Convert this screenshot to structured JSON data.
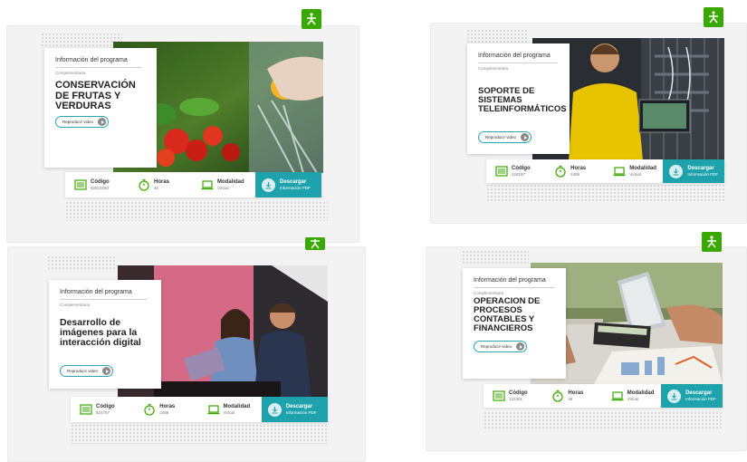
{
  "cards": [
    {
      "info_label": "Información del programa",
      "info_sub": "Complementaria",
      "title": "CONSERVACIÓN DE FRUTAS Y VERDURAS",
      "video_label": "Reproducir video",
      "codigo_label": "Código",
      "codigo_value": "92810260",
      "horas_label": "Horas",
      "horas_value": "48",
      "modalidad_label": "Modalidad",
      "modalidad_value": "Virtual",
      "descargar_label": "Descargar",
      "descargar_sub": "Información PDF"
    },
    {
      "info_label": "Información del programa",
      "info_sub": "Complementaria",
      "title": "SOPORTE DE SISTEMAS TELEINFORMÁTICOS",
      "video_label": "Reproducir video",
      "codigo_label": "Código",
      "codigo_value": "228197",
      "horas_label": "Horas",
      "horas_value": "2496",
      "modalidad_label": "Modalidad",
      "modalidad_value": "Virtual",
      "descargar_label": "Descargar",
      "descargar_sub": "Información PDF"
    },
    {
      "info_label": "Información del programa",
      "info_sub": "Complementaria",
      "title": "Desarrollo de imágenes para la interacción digital",
      "video_label": "Reproducir video",
      "codigo_label": "Código",
      "codigo_value": "524797",
      "horas_label": "Horas",
      "horas_value": "2496",
      "modalidad_label": "Modalidad",
      "modalidad_value": "Virtual",
      "descargar_label": "Descargar",
      "descargar_sub": "Información PDF"
    },
    {
      "info_label": "Información del programa",
      "info_sub": "Complementaria",
      "title": "OPERACION DE PROCESOS CONTABLES Y FINANCIEROS",
      "video_label": "Reproducir video",
      "codigo_label": "Código",
      "codigo_value": "122301",
      "horas_label": "Horas",
      "horas_value": "48",
      "modalidad_label": "Modalidad",
      "modalidad_value": "Virtual",
      "descargar_label": "Descargar",
      "descargar_sub": "Información PDF"
    }
  ],
  "icons": {
    "logo": "sena-logo-icon",
    "codigo": "barcode-icon",
    "horas": "stopwatch-icon",
    "modalidad": "laptop-icon",
    "descargar": "download-pdf-icon",
    "play": "play-icon"
  },
  "colors": {
    "sena_green": "#39a900",
    "accent_teal": "#1ea3ad",
    "icon_green": "#39a900"
  }
}
